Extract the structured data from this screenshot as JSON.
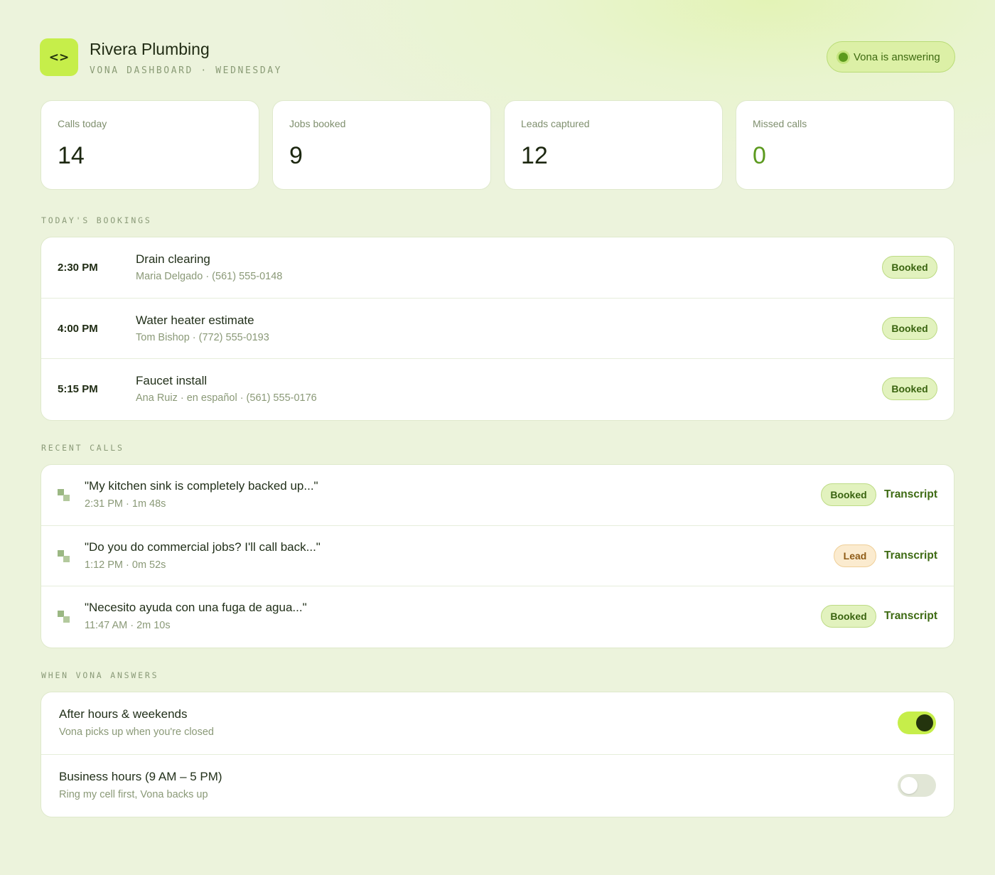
{
  "header": {
    "logo_glyph": "<>",
    "logo_icon": "code-brackets-icon",
    "business_name": "Rivera Plumbing",
    "subtitle": "VONA DASHBOARD · WEDNESDAY",
    "status_label": "Vona is answering"
  },
  "colors": {
    "accent": "#c6ee4a",
    "background": "#ecf3dc",
    "booked": "#e2f2be",
    "lead": "#fbebcf"
  },
  "stats": [
    {
      "label": "Calls today",
      "value": "14"
    },
    {
      "label": "Jobs booked",
      "value": "9"
    },
    {
      "label": "Leads captured",
      "value": "12"
    },
    {
      "label": "Missed calls",
      "value": "0"
    }
  ],
  "bookings": {
    "section_label": "TODAY'S BOOKINGS",
    "items": [
      {
        "time": "2:30 PM",
        "title": "Drain clearing",
        "detail": "Maria Delgado · (561) 555-0148",
        "status": "Booked"
      },
      {
        "time": "4:00 PM",
        "title": "Water heater estimate",
        "detail": "Tom Bishop · (772) 555-0193",
        "status": "Booked"
      },
      {
        "time": "5:15 PM",
        "title": "Faucet install",
        "detail": "Ana Ruiz · en español · (561) 555-0176",
        "status": "Booked"
      }
    ]
  },
  "calls": {
    "section_label": "RECENT CALLS",
    "transcript_label": "Transcript",
    "items": [
      {
        "quote": "\"My kitchen sink is completely backed up...\"",
        "meta": "2:31 PM · 1m 48s",
        "status": "Booked",
        "icon": "waveform-icon"
      },
      {
        "quote": "\"Do you do commercial jobs? I'll call back...\"",
        "meta": "1:12 PM · 0m 52s",
        "status": "Lead",
        "icon": "waveform-icon"
      },
      {
        "quote": "\"Necesito ayuda con una fuga de agua...\"",
        "meta": "11:47 AM · 2m 10s",
        "status": "Booked",
        "icon": "waveform-icon"
      }
    ]
  },
  "settings": {
    "section_label": "WHEN VONA ANSWERS",
    "items": [
      {
        "title": "After hours & weekends",
        "description": "Vona picks up when you're closed",
        "enabled": true
      },
      {
        "title": "Business hours (9 AM – 5 PM)",
        "description": "Ring my cell first, Vona backs up",
        "enabled": false
      }
    ]
  }
}
